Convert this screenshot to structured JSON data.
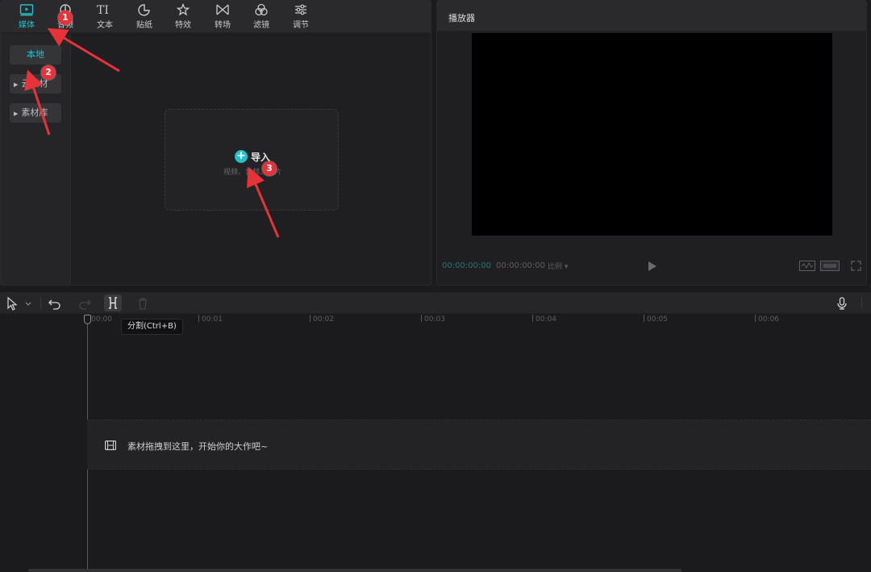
{
  "toolbar": {
    "tabs": [
      {
        "label": "媒体",
        "icon": "media-play-icon"
      },
      {
        "label": "音频",
        "icon": "audio-icon"
      },
      {
        "label": "文本",
        "icon": "text-icon"
      },
      {
        "label": "贴纸",
        "icon": "sticker-icon"
      },
      {
        "label": "特效",
        "icon": "effects-icon"
      },
      {
        "label": "转场",
        "icon": "transition-icon"
      },
      {
        "label": "滤镜",
        "icon": "filter-icon"
      },
      {
        "label": "调节",
        "icon": "adjust-icon"
      }
    ],
    "active_color": "#22c1cf"
  },
  "sidebar": {
    "items": [
      {
        "label": "本地"
      },
      {
        "label": "云素材"
      },
      {
        "label": "素材库"
      }
    ]
  },
  "import": {
    "label": "导入",
    "sub": "视频、音频、图片"
  },
  "player": {
    "title": "播放器",
    "time_current": "00:00:00:00",
    "time_total": "00:00:00:00",
    "ratio": "比例"
  },
  "timeline": {
    "tooltip": "分割(Ctrl+B)",
    "ticks": [
      "00:00",
      "00:01",
      "00:02",
      "00:03",
      "00:04",
      "00:05",
      "00:06"
    ],
    "track_hint": "素材拖拽到这里，开始你的大作吧~"
  },
  "annotations": [
    "1",
    "2",
    "3"
  ]
}
